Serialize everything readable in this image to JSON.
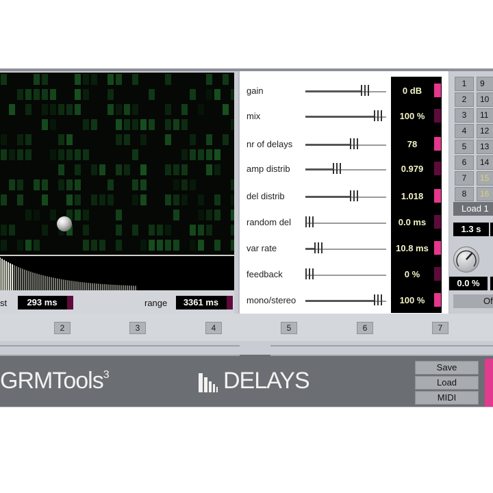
{
  "display": {
    "first_label": "st",
    "first_value": "293 ms",
    "range_label": "range",
    "range_value": "3361 ms"
  },
  "params": [
    {
      "name": "gain",
      "value": "0 dB",
      "level": 0.75,
      "marker_on": true
    },
    {
      "name": "mix",
      "value": "100 %",
      "level": 0.93,
      "marker_on": false
    },
    {
      "name": "nr of delays",
      "value": "78",
      "level": 0.6,
      "marker_on": true
    },
    {
      "name": "amp distrib",
      "value": "0.979",
      "level": 0.37,
      "marker_on": false
    },
    {
      "name": "del distrib",
      "value": "1.018",
      "level": 0.6,
      "marker_on": true
    },
    {
      "name": "random del",
      "value": "0.0 ms",
      "level": 0.0,
      "marker_on": false
    },
    {
      "name": "var rate",
      "value": "10.8 ms",
      "level": 0.12,
      "marker_on": true
    },
    {
      "name": "feedback",
      "value": "0 %",
      "level": 0.0,
      "marker_on": false
    },
    {
      "name": "mono/stereo",
      "value": "100 %",
      "level": 0.93,
      "marker_on": true
    }
  ],
  "presets": {
    "left_col": [
      "1",
      "2",
      "3",
      "4",
      "5",
      "6",
      "7",
      "8"
    ],
    "right_col": [
      "9",
      "10",
      "11",
      "12",
      "13",
      "14",
      "15",
      "16"
    ],
    "load_label": "Load 1",
    "time_value": "1.3 s",
    "knob_value": "0.0 %",
    "off_label": "Of"
  },
  "number_bar": [
    "2",
    "3",
    "4",
    "5",
    "6",
    "7"
  ],
  "footer": {
    "brand": "GRMTools",
    "brand_sup": "3",
    "plugin_name": "DELAYS",
    "save_label": "Save",
    "load_label": "Load",
    "midi_label": "MIDI"
  },
  "colors": {
    "accent_pink": "#e6368d",
    "marker_dark": "#5e0a3c",
    "value_text": "#f4f4c8"
  }
}
